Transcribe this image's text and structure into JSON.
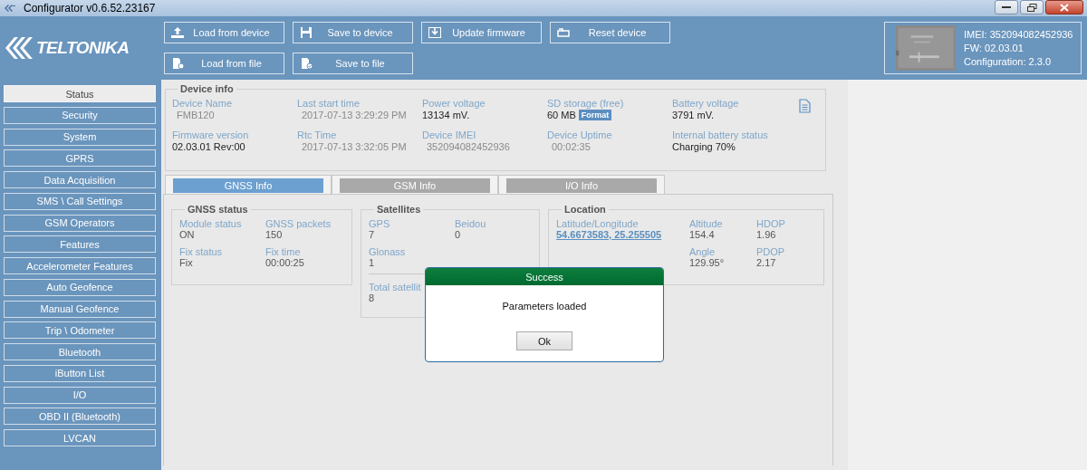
{
  "window": {
    "title": "Configurator v0.6.52.23167"
  },
  "toolbar": [
    {
      "label": "Load from device",
      "kind": "upload"
    },
    {
      "label": "Save to device",
      "kind": "disk"
    },
    {
      "label": "Update firmware",
      "kind": "download"
    },
    {
      "label": "Reset device",
      "kind": "reset"
    },
    {
      "label": "Load from file",
      "kind": "file-add"
    },
    {
      "label": "Save to file",
      "kind": "file-check"
    }
  ],
  "logo": "TELTONIKA",
  "device_card": {
    "lines": [
      "IMEI: 352094082452936",
      "FW: 02.03.01",
      "Configuration: 2.3.0"
    ]
  },
  "sidebar": {
    "items": [
      {
        "label": "Status",
        "selected": true
      },
      {
        "label": "Security",
        "selected": false
      },
      {
        "label": "System",
        "selected": false
      },
      {
        "label": "GPRS",
        "selected": false
      },
      {
        "label": "Data Acquisition",
        "selected": false
      },
      {
        "label": "SMS \\ Call Settings",
        "selected": false
      },
      {
        "label": "GSM Operators",
        "selected": false
      },
      {
        "label": "Features",
        "selected": false
      },
      {
        "label": "Accelerometer Features",
        "selected": false
      },
      {
        "label": "Auto Geofence",
        "selected": false
      },
      {
        "label": "Manual Geofence",
        "selected": false
      },
      {
        "label": "Trip \\ Odometer",
        "selected": false
      },
      {
        "label": "Bluetooth",
        "selected": false
      },
      {
        "label": "iButton List",
        "selected": false
      },
      {
        "label": "I/O",
        "selected": false
      },
      {
        "label": "OBD II (Bluetooth)",
        "selected": false
      },
      {
        "label": "LVCAN",
        "selected": false
      }
    ]
  },
  "device_info": {
    "title": "Device info",
    "fields": [
      {
        "label": "Device Name",
        "value": "FMB120",
        "disabled": true
      },
      {
        "label": "Last start time",
        "value": "2017-07-13 3:29:29 PM",
        "disabled": true
      },
      {
        "label": "Power voltage",
        "value": "13134 mV.",
        "disabled": false
      },
      {
        "label": "SD storage (free)",
        "value": "60 MB",
        "disabled": false,
        "action": "Format"
      },
      {
        "label": "Battery voltage",
        "value": "3791 mV.",
        "disabled": false
      },
      {
        "label": "Firmware version",
        "value": "02.03.01 Rev:00",
        "disabled": false
      },
      {
        "label": "Rtc Time",
        "value": "2017-07-13 3:32:05 PM",
        "disabled": true
      },
      {
        "label": "Device IMEI",
        "value": "352094082452936",
        "disabled": true
      },
      {
        "label": "Device Uptime",
        "value": "00:02:35",
        "disabled": true
      },
      {
        "label": "Internal battery status",
        "value": "Charging 70%",
        "disabled": false
      }
    ]
  },
  "tabs": [
    {
      "label": "GNSS Info",
      "selected": true
    },
    {
      "label": "GSM Info",
      "selected": false
    },
    {
      "label": "I/O Info",
      "selected": false
    }
  ],
  "gnss_status": {
    "title": "GNSS status",
    "fields": [
      {
        "label": "Module status",
        "value": "ON"
      },
      {
        "label": "GNSS packets",
        "value": "150"
      },
      {
        "label": "Fix status",
        "value": "Fix"
      },
      {
        "label": "Fix time",
        "value": "00:00:25"
      }
    ]
  },
  "satellites": {
    "title": "Satellites",
    "fields": [
      {
        "label": "GPS",
        "value": "7"
      },
      {
        "label": "Beidou",
        "value": "0"
      },
      {
        "label": "Glonass",
        "value": "1"
      }
    ],
    "total": {
      "label": "Total satellit",
      "value": "8"
    }
  },
  "location": {
    "title": "Location",
    "coordinates": {
      "label": "Latitude/Longitude",
      "value": "54.6673583, 25.255505"
    },
    "fields": [
      {
        "label": "Altitude",
        "value": "154.4"
      },
      {
        "label": "HDOP",
        "value": "1.96"
      },
      {
        "label": "Angle",
        "value": "129.95°"
      },
      {
        "label": "PDOP",
        "value": "2.17"
      }
    ]
  },
  "dialog": {
    "title": "Success",
    "message": "Parameters loaded",
    "button": "Ok"
  }
}
